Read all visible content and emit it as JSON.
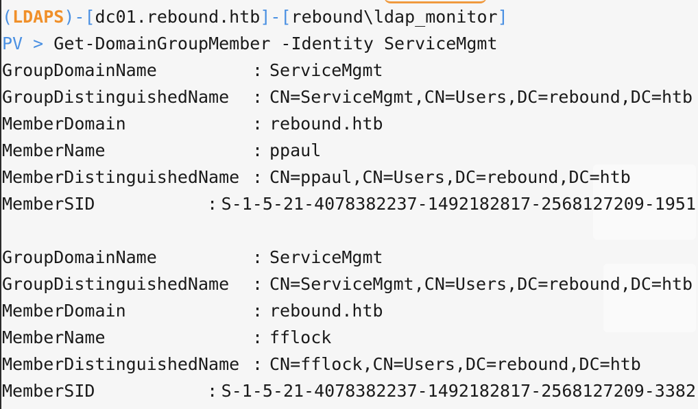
{
  "prompt": {
    "open_paren": "(",
    "ldaps": "LDAPS",
    "close_paren": ")",
    "dash1": "-",
    "lbr1": "[",
    "host": "dc01.rebound.htb",
    "rbr1": "]",
    "dash2": "-",
    "lbr2": "[",
    "user": "rebound\\ldap_monitor",
    "rbr2": "]"
  },
  "command": {
    "shell": "PV",
    "arrow": ">",
    "text": "Get-DomainGroupMember -Identity ServiceMgmt"
  },
  "records": [
    {
      "fields": [
        {
          "key": "GroupDomainName",
          "value": "ServiceMgmt"
        },
        {
          "key": "GroupDistinguishedName",
          "value": "CN=ServiceMgmt,CN=Users,DC=rebound,DC=htb"
        },
        {
          "key": "MemberDomain",
          "value": "rebound.htb"
        },
        {
          "key": "MemberName",
          "value": "ppaul"
        },
        {
          "key": "MemberDistinguishedName",
          "value": "CN=ppaul,CN=Users,DC=rebound,DC=htb"
        },
        {
          "key": "MemberSID",
          "value": "S-1-5-21-4078382237-1492182817-2568127209-1951"
        }
      ]
    },
    {
      "fields": [
        {
          "key": "GroupDomainName",
          "value": "ServiceMgmt"
        },
        {
          "key": "GroupDistinguishedName",
          "value": "CN=ServiceMgmt,CN=Users,DC=rebound,DC=htb"
        },
        {
          "key": "MemberDomain",
          "value": "rebound.htb"
        },
        {
          "key": "MemberName",
          "value": "fflock"
        },
        {
          "key": "MemberDistinguishedName",
          "value": "CN=fflock,CN=Users,DC=rebound,DC=htb"
        },
        {
          "key": "MemberSID",
          "value": "S-1-5-21-4078382237-1492182817-2568127209-3382"
        }
      ]
    }
  ],
  "separator": ":",
  "colors": {
    "background": "#f6f6f6",
    "text": "#1a1a1a",
    "accent_blue": "#4a90e2",
    "accent_orange": "#f0902a"
  }
}
